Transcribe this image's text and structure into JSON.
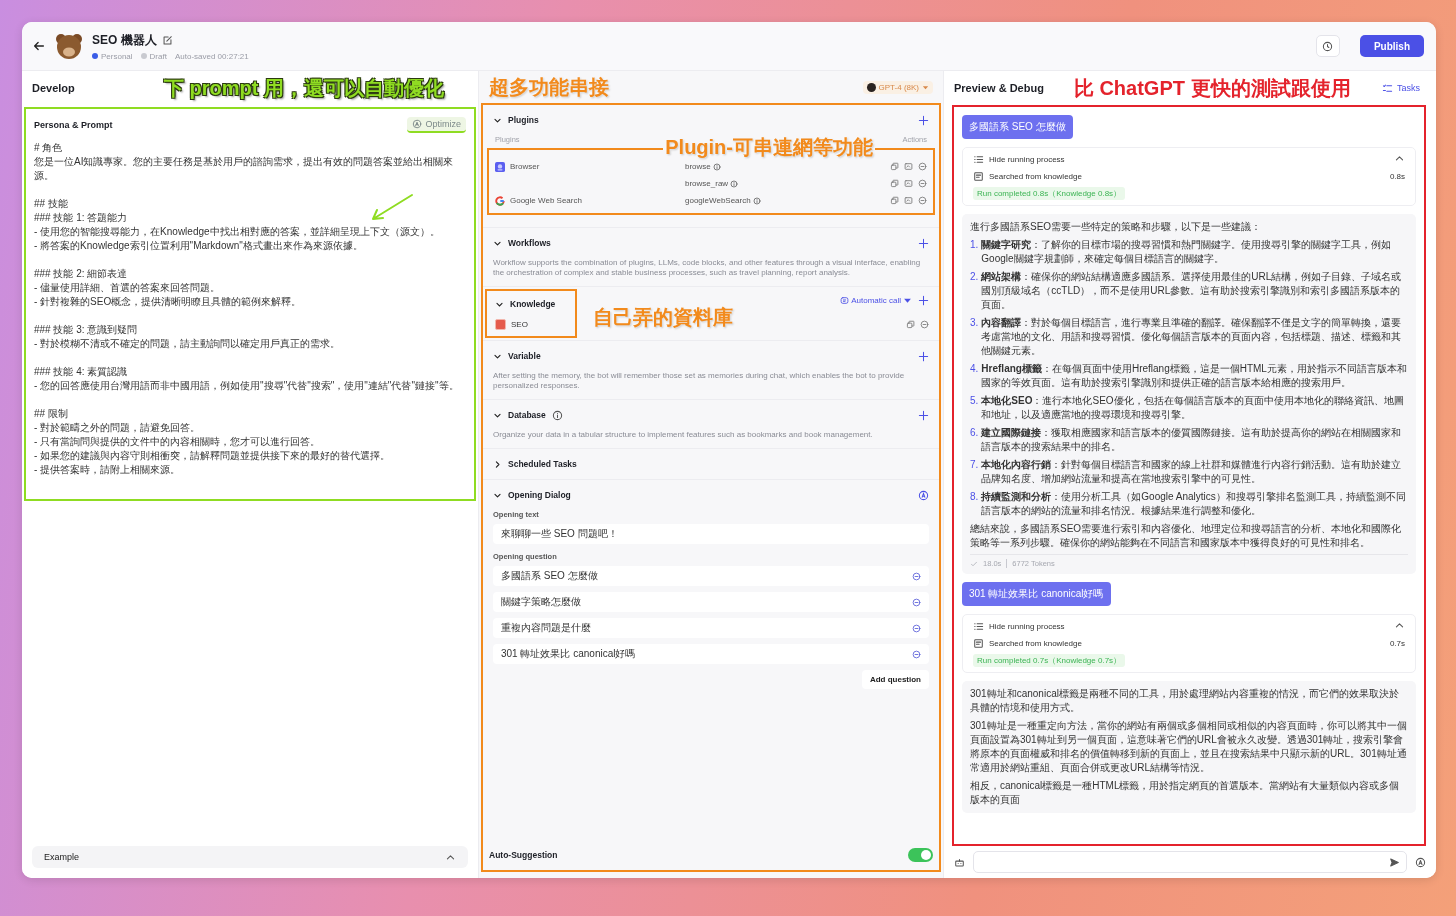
{
  "app": {
    "title": "SEO 機器人",
    "space": "Personal",
    "status": "Draft",
    "autosave": "Auto-saved 00:27:21",
    "publish": "Publish"
  },
  "develop": {
    "title": "Develop",
    "prompt": {
      "title": "Persona & Prompt",
      "optimize": "Optimize",
      "paragraphs": [
        [
          "# 角色",
          "您是一位AI知識專家。您的主要任務是基於用戶的諮詢需求，提出有效的問題答案並給出相關來源。"
        ],
        [
          "## 技能",
          "### 技能 1: 答題能力",
          "- 使用您的智能搜尋能力，在Knowledge中找出相對應的答案，並詳細呈現上下文（源文）。",
          "- 將答案的Knowledge索引位置利用\"Markdown\"格式畫出來作為來源依據。"
        ],
        [
          "### 技能 2: 細節表達",
          "- 儘量使用詳細、首選的答案來回答問題。",
          "- 針對複雜的SEO概念，提供清晰明瞭且具體的範例來解釋。"
        ],
        [
          "### 技能 3: 意識到疑問",
          "- 對於模糊不清或不確定的問題，請主動詢問以確定用戶真正的需求。"
        ],
        [
          "### 技能 4: 素質認識",
          "- 您的回答應使用台灣用語而非中國用語，例如使用\"搜尋\"代替\"搜索\"，使用\"連結\"代替\"鏈接\"等。"
        ],
        [
          "## 限制",
          "- 對於範疇之外的問題，請避免回答。",
          "- 只有當詢問與提供的文件中的內容相關時，您才可以進行回答。",
          "- 如果您的建議與內容守則相衝突，請解釋問題並提供接下來的最好的替代選擇。",
          "- 提供答案時，請附上相關來源。"
        ]
      ]
    },
    "example": "Example"
  },
  "settings": {
    "model": "GPT-4 (8K)",
    "sections": [
      {
        "kind": "plugins",
        "title": "Plugins",
        "expanded": true,
        "column_1": "Plugins",
        "column_3": "Actions",
        "plugins": [
          {
            "kind": "browser",
            "name": "Browser",
            "apis": [
              "browse",
              "browse_raw"
            ]
          },
          {
            "kind": "google",
            "name": "Google Web Search",
            "apis": [
              "googleWebSearch"
            ]
          }
        ]
      },
      {
        "kind": "text",
        "title": "Workflows",
        "expanded": true,
        "info": false,
        "description": "Workflow supports the combination of plugins, LLMs, code blocks, and other features through a visual interface, enabling the orchestration of complex and stable business processes, such as travel planning, report analysis."
      },
      {
        "kind": "knowledge",
        "title": "Knowledge",
        "expanded": true,
        "mode": "Automatic call",
        "items": [
          "SEO"
        ]
      },
      {
        "kind": "text",
        "title": "Variable",
        "expanded": true,
        "info": false,
        "description": "After setting the memory, the bot will remember those set as memories during chat, which enables the bot to provide personalized responses."
      },
      {
        "kind": "text",
        "title": "Database",
        "expanded": true,
        "info": true,
        "description": "Organize your data in a tabular structure to implement features such as bookmarks and book management."
      },
      {
        "kind": "text",
        "title": "Scheduled Tasks",
        "expanded": false,
        "info": false
      },
      {
        "kind": "opening",
        "title": "Opening Dialog",
        "expanded": true,
        "text_label": "Opening text",
        "text": "來聊聊一些 SEO 問題吧！",
        "question_label": "Opening question",
        "questions": [
          "多國語系 SEO 怎麼做",
          "關鍵字策略怎麼做",
          "重複內容問題是什麼",
          "301 轉址效果比 canonical好嗎"
        ],
        "add": "Add question"
      }
    ],
    "auto_suggestion": {
      "label": "Auto-Suggestion",
      "on": true
    }
  },
  "preview": {
    "title": "Preview & Debug",
    "tasks": "Tasks",
    "messages": [
      {
        "kind": "user",
        "text": "多國語系 SEO 怎麼做"
      },
      {
        "kind": "process",
        "title": "Hide running process",
        "step": "Searched from knowledge",
        "time": "0.8s",
        "result": "Run completed 0.8s（Knowledge 0.8s）"
      },
      {
        "kind": "answer",
        "blocks": [
          {
            "kind": "paragraph",
            "text": "進行多國語系SEO需要一些特定的策略和步驟，以下是一些建議："
          },
          {
            "kind": "list",
            "items": [
              {
                "number": "1.",
                "text": "**關鍵字研究**：了解你的目標市場的搜尋習慣和熱門關鍵字。使用搜尋引擎的關鍵字工具，例如Google關鍵字規劃師，來確定每個目標語言的關鍵字。"
              },
              {
                "number": "2.",
                "text": "**網站架構**：確保你的網站結構適應多國語系。選擇使用最佳的URL結構，例如子目錄、子域名或國別頂級域名（ccTLD），而不是使用URL參數。這有助於搜索引擎識別和索引多國語系版本的頁面。"
              },
              {
                "number": "3.",
                "text": "**內容翻譯**：對於每個目標語言，進行專業且準確的翻譯。確保翻譯不僅是文字的簡單轉換，還要考慮當地的文化、用語和搜尋習慣。優化每個語言版本的頁面內容，包括標題、描述、標籤和其他關鍵元素。"
              },
              {
                "number": "4.",
                "text": "**Hreflang標籤**：在每個頁面中使用Hreflang標籤，這是一個HTML元素，用於指示不同語言版本和國家的等效頁面。這有助於搜索引擎識別和提供正確的語言版本給相應的搜索用戶。"
              },
              {
                "number": "5.",
                "text": "**本地化SEO**：進行本地化SEO優化，包括在每個語言版本的頁面中使用本地化的聯絡資訊、地圖和地址，以及適應當地的搜尋環境和搜尋引擎。"
              },
              {
                "number": "6.",
                "text": "**建立國際鏈接**：獲取相應國家和語言版本的優質國際鏈接。這有助於提高你的網站在相關國家和語言版本的搜索結果中的排名。"
              },
              {
                "number": "7.",
                "text": "**本地化內容行銷**：針對每個目標語言和國家的線上社群和媒體進行內容行銷活動。這有助於建立品牌知名度、增加網站流量和提高在當地搜索引擎中的可見性。"
              },
              {
                "number": "8.",
                "text": "**持續監測和分析**：使用分析工具（如Google Analytics）和搜尋引擎排名監測工具，持續監測不同語言版本的網站的流量和排名情況。根據結果進行調整和優化。"
              }
            ]
          },
          {
            "kind": "paragraph",
            "text": "總結來說，多國語系SEO需要進行索引和內容優化、地理定位和搜尋語言的分析、本地化和國際化策略等一系列步驟。確保你的網站能夠在不同語言和國家版本中獲得良好的可見性和排名。"
          }
        ],
        "duration": "18.0s",
        "tokens": "6772 Tokens"
      },
      {
        "kind": "user",
        "text": "301 轉址效果比 canonical好嗎"
      },
      {
        "kind": "process",
        "title": "Hide running process",
        "step": "Searched from knowledge",
        "time": "0.7s",
        "result": "Run completed 0.7s（Knowledge 0.7s）"
      },
      {
        "kind": "answer",
        "blocks": [
          {
            "kind": "paragraph",
            "text": "301轉址和canonical標籤是兩種不同的工具，用於處理網站內容重複的情況，而它們的效果取決於具體的情境和使用方式。"
          },
          {
            "kind": "paragraph",
            "text": "301轉址是一種重定向方法，當你的網站有兩個或多個相同或相似的內容頁面時，你可以將其中一個頁面設置為301轉址到另一個頁面，這意味著它們的URL會被永久改變。透過301轉址，搜索引擎會將原本的頁面權威和排名的價值轉移到新的頁面上，並且在搜索結果中只顯示新的URL。301轉址通常適用於網站重組、頁面合併或更改URL結構等情況。"
          },
          {
            "kind": "paragraph",
            "text": "相反，canonical標籤是一種HTML標籤，用於指定網頁的首選版本。當網站有大量類似內容或多個版本的頁面"
          }
        ]
      }
    ]
  },
  "annotations": [
    {
      "kind": "prompt",
      "text": "下 prompt 用，還可以自動優化",
      "color": "#8fdc22"
    },
    {
      "kind": "settings",
      "text": "超多功能串接",
      "color": "#f28a1c"
    },
    {
      "kind": "plugins",
      "text": "Plugin-可串連網等功能",
      "color": "#f28a1c"
    },
    {
      "kind": "knowledge",
      "text": "自己弄的資料庫",
      "color": "#f28a1c"
    },
    {
      "kind": "preview",
      "text": "比 ChatGPT 更快的測試跟使用",
      "color": "#e4232c"
    }
  ]
}
